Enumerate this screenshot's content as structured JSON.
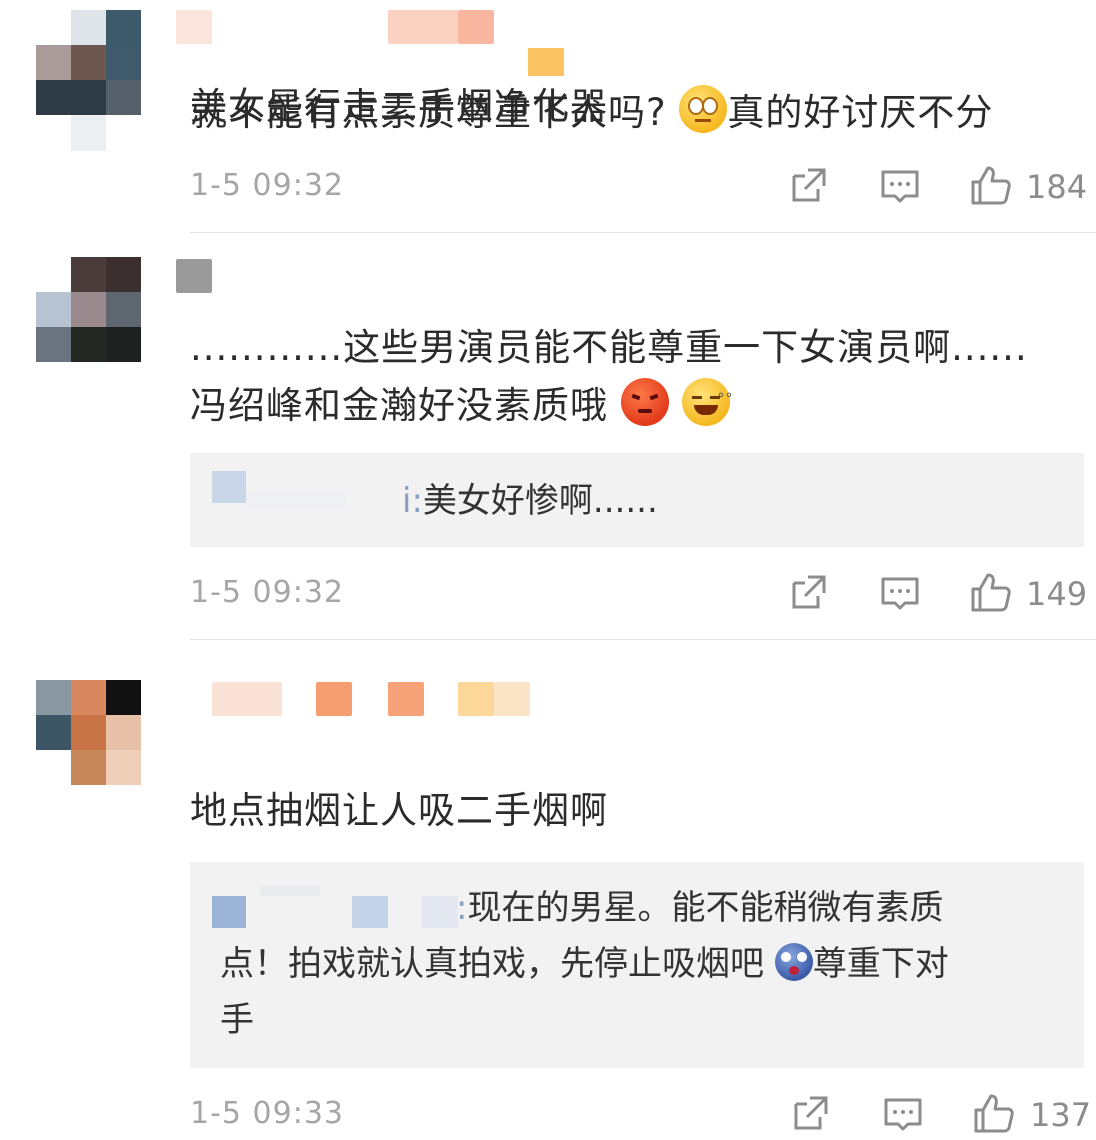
{
  "comments": [
    {
      "text_lines": [
        "美女是行走二手烟净化器"
      ],
      "time": "1-5 09:32",
      "likes": "184"
    },
    {
      "text_lines": [
        "............这些男演员能不能尊重一下女演员啊......",
        "冯绍峰和金瀚好没素质哦"
      ],
      "emojis": [
        "angry-face-emoji",
        "dizzy-grin-emoji"
      ],
      "reply": {
        "name_tail": "i:",
        "text": "美女好惨啊......"
      },
      "time": "1-5 09:32",
      "likes": "149"
    },
    {
      "text_lines": [
        "就不能有点素质尊重下人吗?",
        "真的好讨厌不分",
        "地点抽烟让人吸二手烟啊"
      ],
      "emojis": [
        "rolling-eyes-emoji"
      ],
      "reply": {
        "name_tail": ":",
        "lines": [
          "现在的男星。能不能稍微有素质",
          "点！拍戏就认真拍戏，先停止吸烟吧",
          "尊重下对",
          "手"
        ],
        "emojis": [
          "shocked-face-emoji"
        ]
      },
      "time": "1-5 09:33",
      "likes": "137"
    }
  ],
  "icons": [
    "share-icon",
    "comment-icon",
    "like-icon"
  ],
  "colors": {
    "text": "#2b2b2b",
    "meta": "#a6a6a6",
    "reply_bg": "#f2f2f2",
    "icon": "#8c8c8c"
  }
}
